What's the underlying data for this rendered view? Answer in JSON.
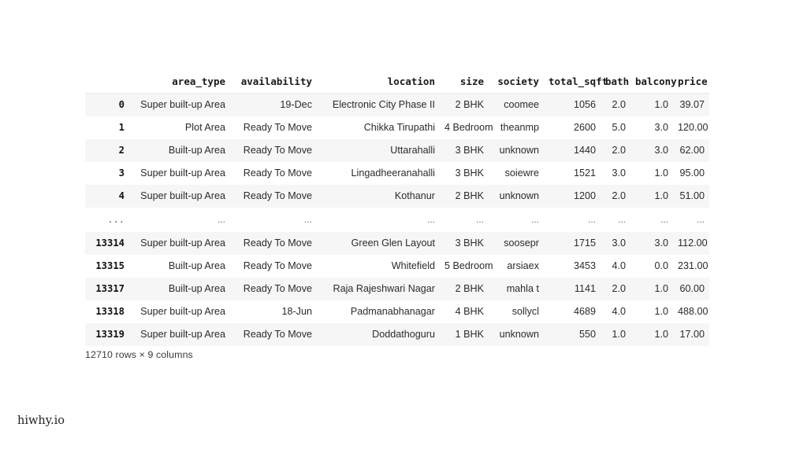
{
  "watermark": "hiwhy.io",
  "dataframe": {
    "index_header": "",
    "columns": [
      "area_type",
      "availability",
      "location",
      "size",
      "society",
      "total_sqft",
      "bath",
      "balcony",
      "price"
    ],
    "ellipsis": "...",
    "footer": "12710 rows × 9 columns",
    "rows": [
      {
        "index": "0",
        "cells": [
          "Super built-up Area",
          "19-Dec",
          "Electronic City Phase II",
          "2 BHK",
          "coomee",
          "1056",
          "2.0",
          "1.0",
          "39.07"
        ]
      },
      {
        "index": "1",
        "cells": [
          "Plot Area",
          "Ready To Move",
          "Chikka Tirupathi",
          "4 Bedroom",
          "theanmp",
          "2600",
          "5.0",
          "3.0",
          "120.00"
        ]
      },
      {
        "index": "2",
        "cells": [
          "Built-up Area",
          "Ready To Move",
          "Uttarahalli",
          "3 BHK",
          "unknown",
          "1440",
          "2.0",
          "3.0",
          "62.00"
        ]
      },
      {
        "index": "3",
        "cells": [
          "Super built-up Area",
          "Ready To Move",
          "Lingadheeranahalli",
          "3 BHK",
          "soiewre",
          "1521",
          "3.0",
          "1.0",
          "95.00"
        ]
      },
      {
        "index": "4",
        "cells": [
          "Super built-up Area",
          "Ready To Move",
          "Kothanur",
          "2 BHK",
          "unknown",
          "1200",
          "2.0",
          "1.0",
          "51.00"
        ]
      },
      {
        "index": "...",
        "cells": [
          "...",
          "...",
          "...",
          "...",
          "...",
          "...",
          "...",
          "...",
          "..."
        ],
        "is_ellipsis": true
      },
      {
        "index": "13314",
        "cells": [
          "Super built-up Area",
          "Ready To Move",
          "Green Glen Layout",
          "3 BHK",
          "soosepr",
          "1715",
          "3.0",
          "3.0",
          "112.00"
        ]
      },
      {
        "index": "13315",
        "cells": [
          "Built-up Area",
          "Ready To Move",
          "Whitefield",
          "5 Bedroom",
          "arsiaex",
          "3453",
          "4.0",
          "0.0",
          "231.00"
        ]
      },
      {
        "index": "13317",
        "cells": [
          "Built-up Area",
          "Ready To Move",
          "Raja Rajeshwari Nagar",
          "2 BHK",
          "mahla t",
          "1141",
          "2.0",
          "1.0",
          "60.00"
        ]
      },
      {
        "index": "13318",
        "cells": [
          "Super built-up Area",
          "18-Jun",
          "Padmanabhanagar",
          "4 BHK",
          "sollycl",
          "4689",
          "4.0",
          "1.0",
          "488.00"
        ]
      },
      {
        "index": "13319",
        "cells": [
          "Super built-up Area",
          "Ready To Move",
          "Doddathoguru",
          "1 BHK",
          "unknown",
          "550",
          "1.0",
          "1.0",
          "17.00"
        ]
      }
    ]
  },
  "colors": {
    "background": "#ffffff",
    "stripe": "#f6f6f6",
    "text": "#2b2b2b",
    "header_text": "#1a1a1a",
    "header_rule": "#e8e8e8"
  }
}
